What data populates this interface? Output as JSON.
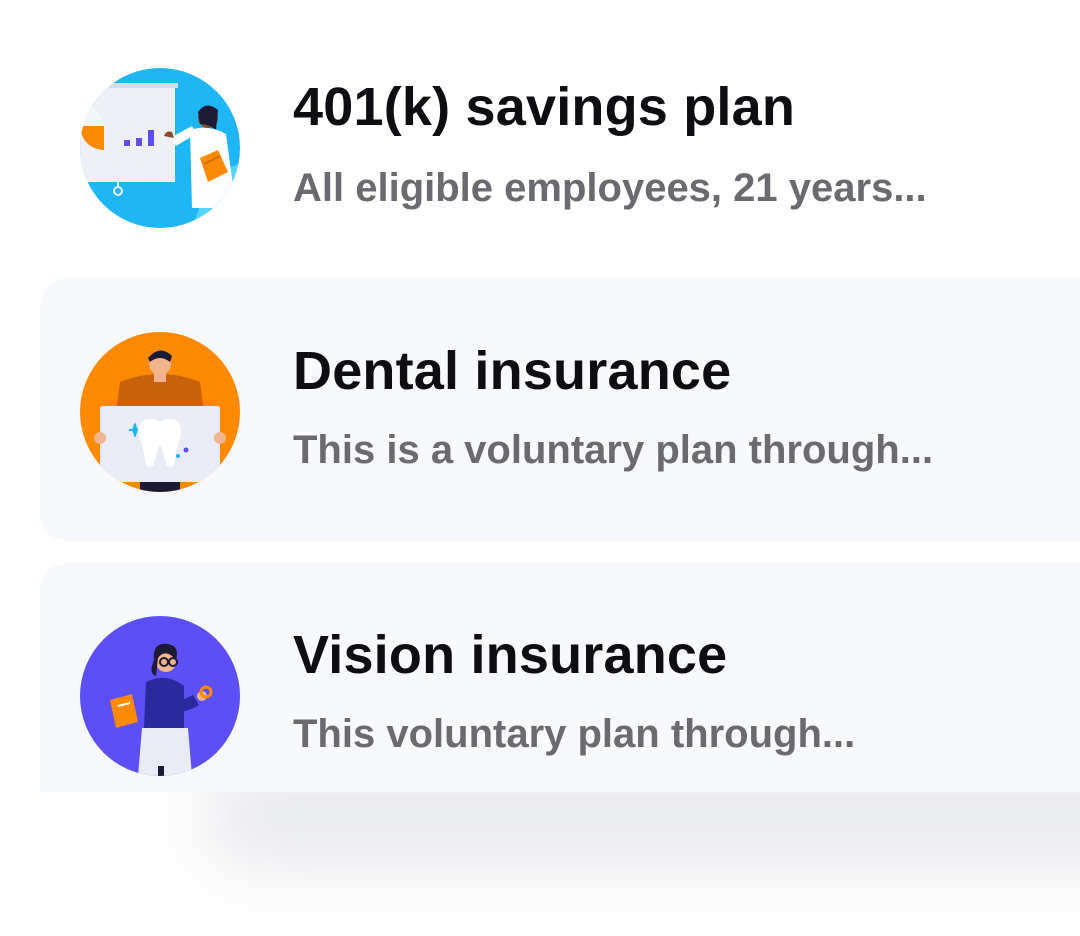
{
  "benefits": [
    {
      "title": "401(k) savings plan",
      "description": "All eligible employees, 21 years...",
      "illustration": "presentation-chart-illustration",
      "bg_color": "#1fb6f5"
    },
    {
      "title": "Dental insurance",
      "description": "This is a voluntary plan through...",
      "illustration": "tooth-sign-illustration",
      "bg_color": "#ff8a00"
    },
    {
      "title": "Vision insurance",
      "description": "This voluntary plan through...",
      "illustration": "glasses-person-illustration",
      "bg_color": "#5b4ff5"
    }
  ],
  "colors": {
    "title": "#0d0d12",
    "description": "#6a6a70",
    "card_shade": "#f8f9fd"
  }
}
